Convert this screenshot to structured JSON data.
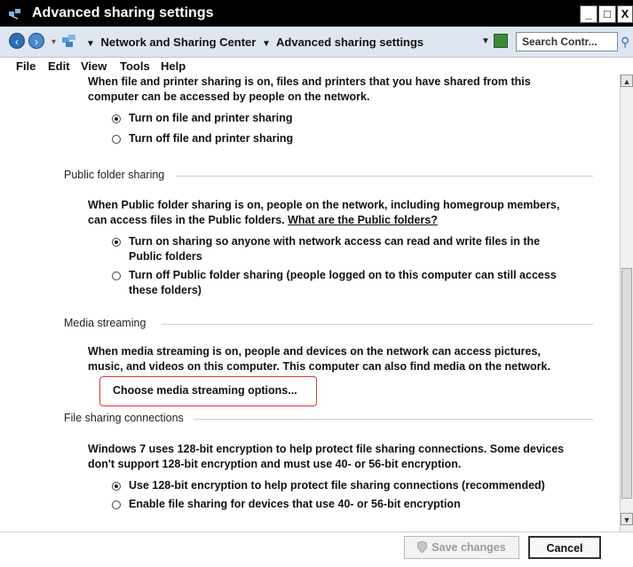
{
  "window": {
    "title": "Advanced sharing settings",
    "minimize": "_",
    "maximize": "□",
    "close": "X"
  },
  "address": {
    "breadcrumbs": [
      "Network and Sharing Center",
      "Advanced sharing settings"
    ],
    "search_placeholder": "Search Contr..."
  },
  "menu": [
    "File",
    "Edit",
    "View",
    "Tools",
    "Help"
  ],
  "file_printer": {
    "desc_line1": "When file and printer sharing is on, files and printers that you have shared from this",
    "desc_line2": "computer can be accessed by people on the network.",
    "on_label": "Turn on file and printer sharing",
    "off_label": "Turn off file and printer sharing",
    "selected": "on"
  },
  "public_folder": {
    "section_title": "Public folder sharing",
    "desc_line1": "When Public folder sharing is on, people on the network, including homegroup members,",
    "desc_line2_prefix": "can access files in the Public folders.",
    "desc_link": "What are the Public folders?",
    "on_label_line1": "Turn on sharing so anyone with network access can read and write files in the",
    "on_label_line2": "Public folders",
    "off_label_line1": "Turn off Public folder sharing (people logged on to this computer can still access",
    "off_label_line2": "these folders)",
    "selected": "on"
  },
  "media": {
    "section_title": "Media streaming",
    "desc_line1": "When media streaming is on, people and devices on the network can access pictures,",
    "desc_line2": "music, and videos on this computer. This computer can also find media on the network.",
    "button_label": "Choose media streaming options..."
  },
  "file_sharing": {
    "section_title": "File sharing connections",
    "desc_line1": "Windows 7 uses 128-bit encryption to help protect file sharing connections. Some devices",
    "desc_line2": "don't support 128-bit encryption and must use 40- or 56-bit encryption.",
    "opt1_label": "Use 128-bit encryption to help protect file sharing connections (recommended)",
    "opt2_label": "Enable file sharing for devices that use 40- or 56-bit encryption",
    "selected": "128"
  },
  "footer": {
    "save_label": "Save changes",
    "cancel_label": "Cancel"
  }
}
